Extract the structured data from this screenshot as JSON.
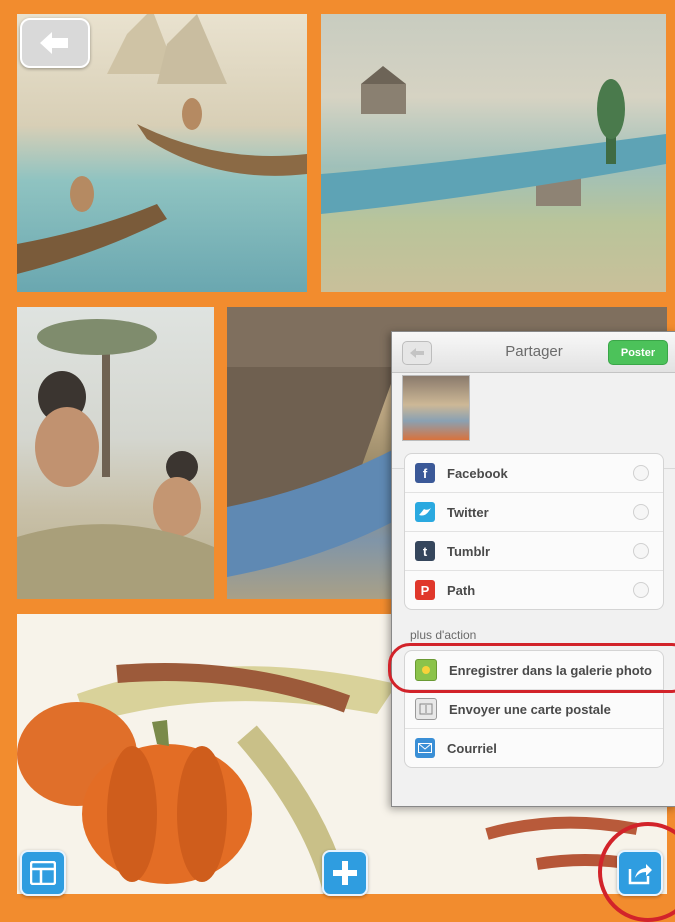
{
  "share_panel": {
    "title": "Partager",
    "post_button": "Poster",
    "social_items": [
      {
        "label": "Facebook",
        "icon": "facebook-icon",
        "color": "#3b5998"
      },
      {
        "label": "Twitter",
        "icon": "twitter-icon",
        "color": "#2aa9e0"
      },
      {
        "label": "Tumblr",
        "icon": "tumblr-icon",
        "color": "#35465c"
      },
      {
        "label": "Path",
        "icon": "path-icon",
        "color": "#e0382b"
      }
    ],
    "section_label": "plus d'action",
    "action_items": [
      {
        "label": "Enregistrer dans la galerie photo",
        "icon": "photo-gallery-icon"
      },
      {
        "label": "Envoyer une carte postale",
        "icon": "postcard-icon"
      },
      {
        "label": "Courriel",
        "icon": "mail-icon"
      }
    ]
  },
  "colors": {
    "frame": "#f28c2e",
    "toolbar_button": "#2f9de0",
    "highlight": "#d2232a",
    "post_button": "#4cc25a"
  }
}
